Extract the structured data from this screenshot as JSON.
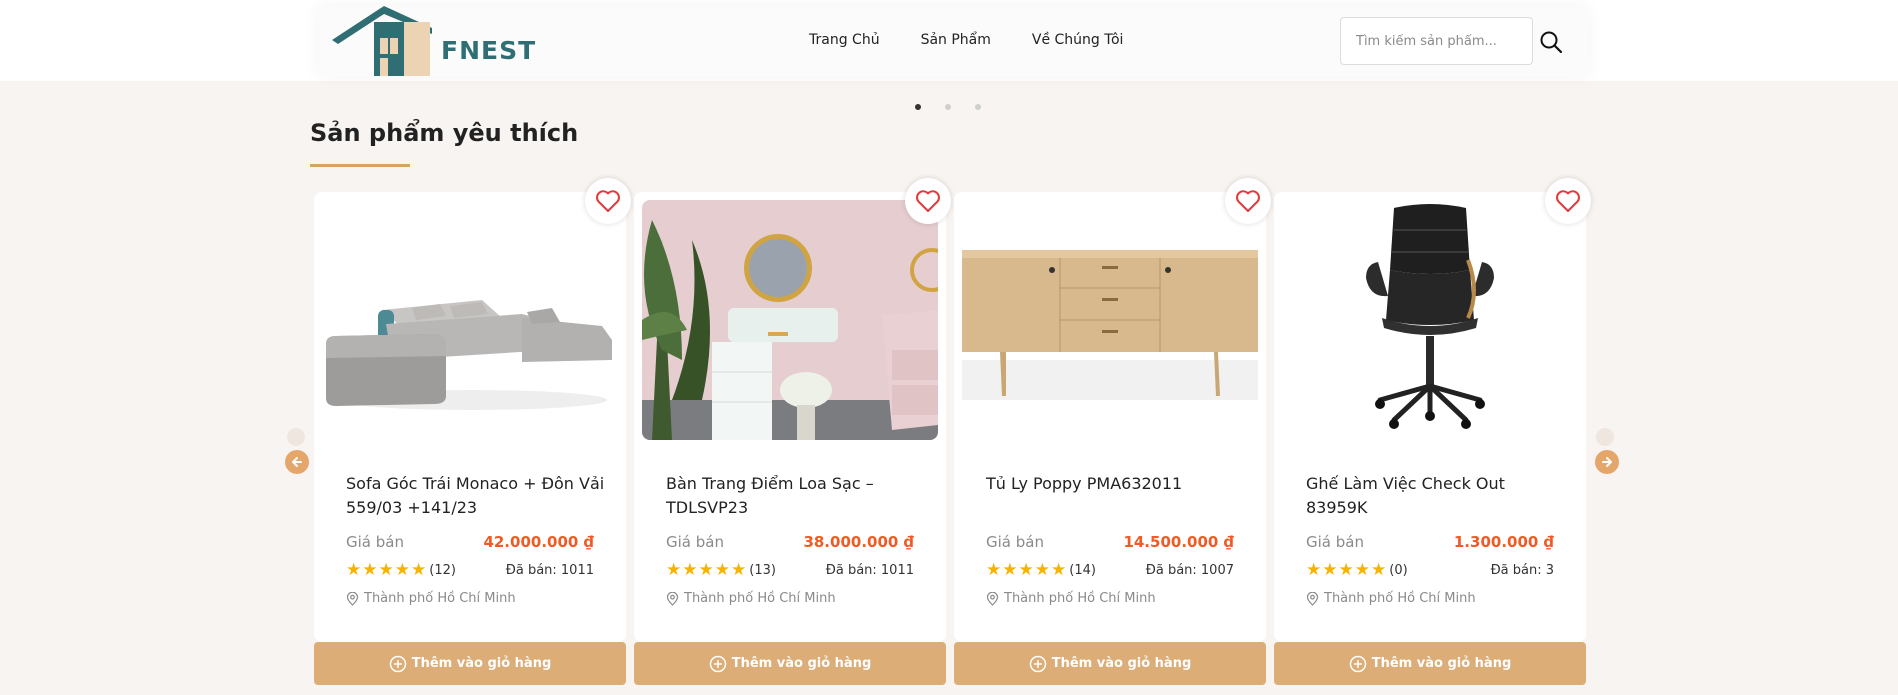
{
  "brand": {
    "name": "FNEST"
  },
  "nav": {
    "items": [
      "Trang Chủ",
      "Sản Phẩm",
      "Về Chúng Tôi"
    ]
  },
  "search": {
    "placeholder": "Tìm kiếm sản phẩm...",
    "value": "",
    "icon": "search-icon"
  },
  "carousel": {
    "active_dot": 0,
    "dot_count": 3
  },
  "section": {
    "title": "Sản phẩm yêu thích"
  },
  "colors": {
    "accent": "#ddad77",
    "underline": "#d9a35f",
    "price": "#f05a23",
    "star": "#f5b400",
    "heart": "#e2393f",
    "logo": "#2f6f74"
  },
  "products": [
    {
      "name": "Sofa Góc Trái Monaco + Đôn Vải 559/03 +141/23",
      "price_label": "Giá bán",
      "price": "42.000.000 ₫",
      "reviews": "(12)",
      "sold": "Đã bán: 1011",
      "location": "Thành phố Hồ Chí Minh",
      "rating": 5
    },
    {
      "name": "Bàn Trang Điểm Loa Sạc – TDLSVP23",
      "price_label": "Giá bán",
      "price": "38.000.000 ₫",
      "reviews": "(13)",
      "sold": "Đã bán: 1011",
      "location": "Thành phố Hồ Chí Minh",
      "rating": 5
    },
    {
      "name": "Tủ Ly Poppy PMA632011",
      "price_label": "Giá bán",
      "price": "14.500.000 ₫",
      "reviews": "(14)",
      "sold": "Đã bán: 1007",
      "location": "Thành phố Hồ Chí Minh",
      "rating": 5
    },
    {
      "name": "Ghế Làm Việc Check Out 83959K",
      "price_label": "Giá bán",
      "price": "1.300.000 ₫",
      "reviews": "(0)",
      "sold": "Đã bán: 3",
      "location": "Thành phố Hồ Chí Minh",
      "rating": 5
    }
  ],
  "cart_button": {
    "label": "Thêm vào giỏ hàng"
  }
}
